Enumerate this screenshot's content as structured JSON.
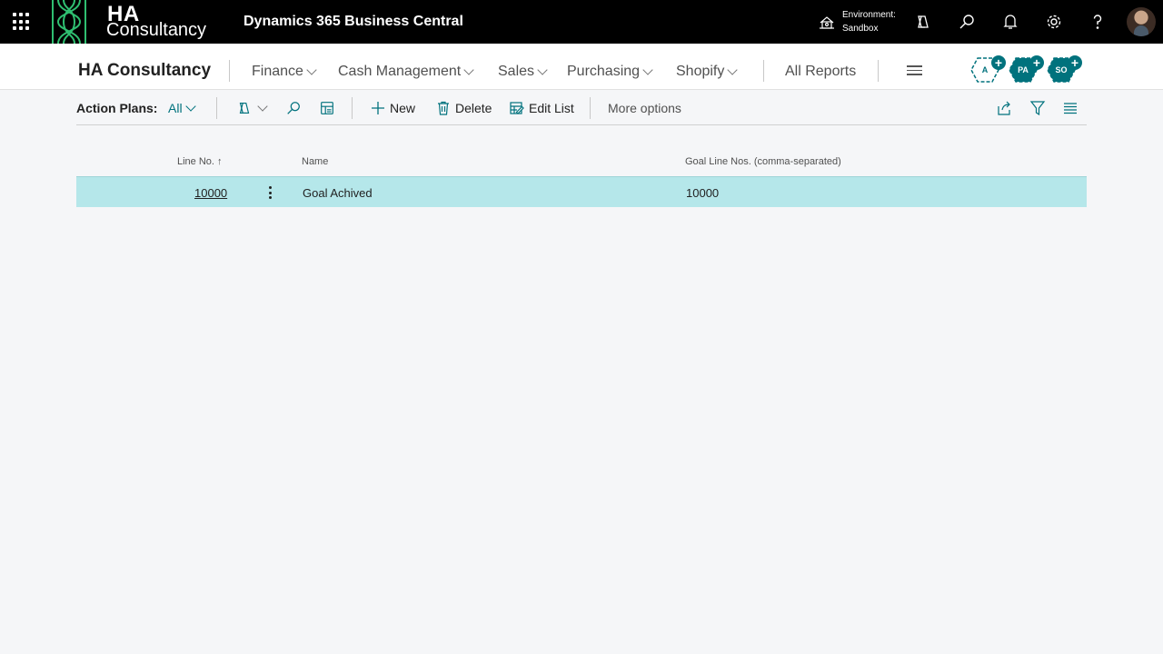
{
  "topbar": {
    "logo_main": "HA",
    "logo_sub": "Consultancy",
    "app_title": "Dynamics 365 Business Central",
    "environment_label": "Environment:",
    "environment_value": "Sandbox",
    "icons": [
      "waffle-icon",
      "environment-icon",
      "copilot-icon",
      "search-icon",
      "bell-icon",
      "gear-icon",
      "help-icon",
      "avatar"
    ]
  },
  "nav": {
    "company": "HA Consultancy",
    "items": [
      {
        "label": "Finance"
      },
      {
        "label": "Cash Management"
      },
      {
        "label": "Sales"
      },
      {
        "label": "Purchasing"
      },
      {
        "label": "Shopify"
      }
    ],
    "all_reports": "All Reports",
    "badges": [
      {
        "text": "A"
      },
      {
        "text": "PA"
      },
      {
        "text": "SO"
      }
    ]
  },
  "actionbar": {
    "caption": "Action Plans:",
    "filter_view": "All",
    "new_label": "New",
    "delete_label": "Delete",
    "edit_list_label": "Edit List",
    "more_options": "More options"
  },
  "grid": {
    "columns": [
      "Line No.",
      "Name",
      "Goal Line Nos. (comma-separated)"
    ],
    "sort_indicator": "↑",
    "rows": [
      {
        "line_no": "10000",
        "name": "Goal Achived",
        "goal_line_nos": "10000"
      }
    ]
  },
  "colors": {
    "accent": "#00727d",
    "selected_row": "#b5e7ea",
    "topbar": "#000000",
    "logo_green": "#2fbf71"
  }
}
